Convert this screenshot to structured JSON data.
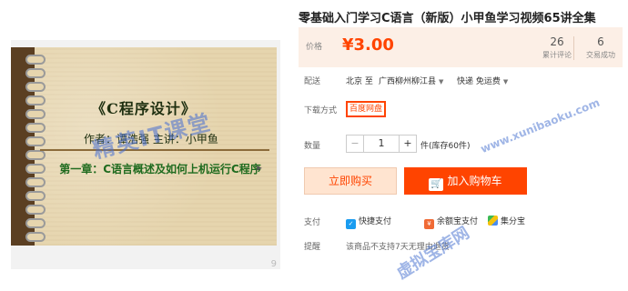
{
  "product": {
    "title": "零基础入门学习C语言（新版）小甲鱼学习视频65讲全集"
  },
  "slide": {
    "title": "《C程序设计》",
    "author_line": "作者：谭浩强    主讲：小甲鱼",
    "chapter_line": "第一章：C语言概述及如何上机运行C程序",
    "watermark": "精英IT课堂",
    "corner_mark": "9"
  },
  "price": {
    "label": "价格",
    "value": "¥3.00",
    "reviews_count": "26",
    "reviews_label": "累计评论",
    "sales_count": "6",
    "sales_label": "交易成功"
  },
  "shipping": {
    "label": "配送",
    "from": "北京 至",
    "to": "广西柳州柳江县",
    "method": "快递 免运费"
  },
  "service": {
    "label": "下载方式",
    "option": "百度网盘"
  },
  "quantity": {
    "label": "数量",
    "minus": "−",
    "value": "1",
    "plus": "+",
    "stock": "件(库存60件)"
  },
  "actions": {
    "buy_now": "立即购买",
    "add_to_cart": "加入购物车"
  },
  "payment": {
    "label": "支付",
    "methods": [
      "快捷支付",
      "余额宝支付",
      "集分宝"
    ]
  },
  "notice": {
    "label": "提醒",
    "text": "该商品不支持7天无理由退货"
  },
  "watermarks": {
    "url": "www.xunibaoku.com",
    "site": "虚拟宝库网"
  },
  "colors": {
    "accent": "#ff4400",
    "price_bg": "#fcefe6",
    "watermark": "#5078d2"
  }
}
